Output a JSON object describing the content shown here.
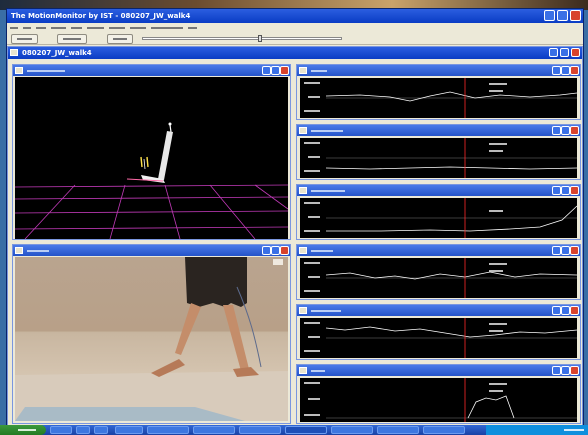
{
  "app": {
    "title": "The MotionMonitor by IST - 080207_JW_walk4"
  },
  "document": {
    "title": "080207_JW_walk4"
  },
  "panels": [
    {
      "id": "animation",
      "type": "3d-view"
    },
    {
      "id": "video",
      "type": "video"
    },
    {
      "id": "graph-1",
      "type": "graph"
    },
    {
      "id": "graph-2",
      "type": "graph"
    },
    {
      "id": "graph-3",
      "type": "graph"
    },
    {
      "id": "graph-4",
      "type": "graph"
    },
    {
      "id": "graph-5",
      "type": "graph"
    },
    {
      "id": "graph-6",
      "type": "graph"
    }
  ],
  "colors": {
    "titlebar": "#0a3cc4",
    "panel_titlebar": "#2453c9",
    "grid": "#c13ab8",
    "plot_trace": "#ffffff",
    "marker": "#ff2a2a",
    "taskbar": "#1941a5",
    "start": "#237a23"
  },
  "icons": [
    "minimize-icon",
    "maximize-icon",
    "close-icon",
    "window-icon"
  ]
}
